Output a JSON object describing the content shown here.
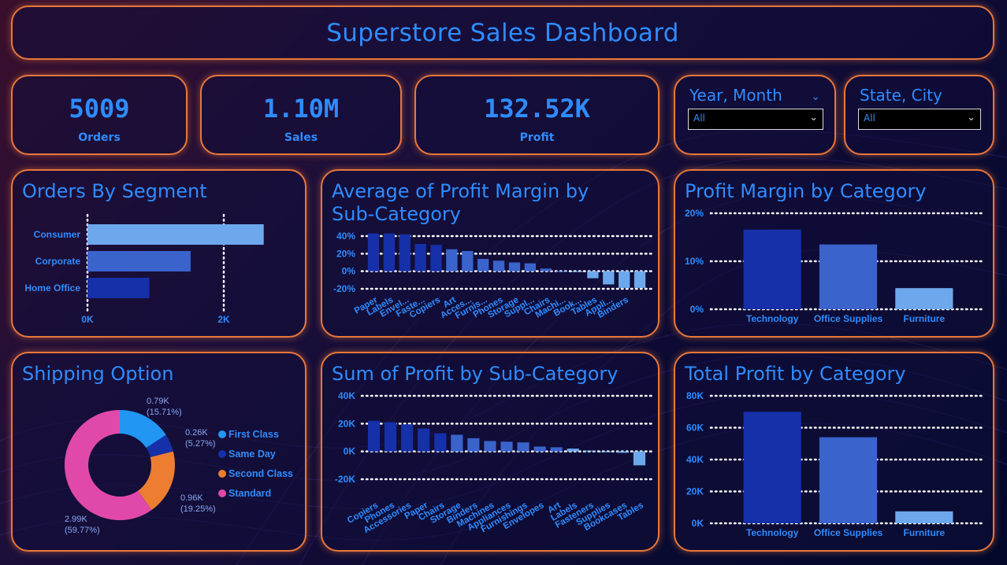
{
  "header": {
    "title": "Superstore Sales Dashboard"
  },
  "kpis": {
    "orders": {
      "value": "5009",
      "label": "Orders"
    },
    "sales": {
      "value": "1.10M",
      "label": "Sales"
    },
    "profit": {
      "value": "132.52K",
      "label": "Profit"
    }
  },
  "filters": {
    "year_month": {
      "label": "Year, Month",
      "value": "All"
    },
    "state_city": {
      "label": "State, City",
      "value": "All"
    }
  },
  "panels": {
    "orders_by_segment": "Orders By Segment",
    "avg_profit_margin_subcat": "Average of Profit Margin by Sub-Category",
    "profit_margin_category": "Profit Margin by Category",
    "shipping_option": "Shipping Option",
    "sum_profit_subcat": "Sum of Profit by Sub-Category",
    "total_profit_category": "Total Profit by Category"
  },
  "colors": {
    "accent": "#2f8cff",
    "border": "#e8773a",
    "bar_dark": "#1530a8",
    "bar_mid": "#3a63cc",
    "bar_light": "#6ea8ec",
    "first_class": "#2196f3",
    "same_day": "#1530a8",
    "second_class": "#ed7d31",
    "standard": "#e049aa"
  },
  "chart_data": [
    {
      "id": "segment",
      "type": "bar",
      "orientation": "horizontal",
      "categories": [
        "Consumer",
        "Corporate",
        "Home Office"
      ],
      "values": [
        2586,
        1514,
        909
      ],
      "xlim": [
        0,
        2000
      ],
      "xticks": [
        "0K",
        "2K"
      ],
      "grid": true
    },
    {
      "id": "avg_margin",
      "type": "bar",
      "categories": [
        "Paper",
        "Labels",
        "Envel...",
        "Faste...",
        "Copiers",
        "Art",
        "Acces...",
        "Furnis...",
        "Phones",
        "Storage",
        "Suppl...",
        "Chairs",
        "Machi...",
        "Book...",
        "Tables",
        "Appli...",
        "Binders"
      ],
      "values": [
        0.43,
        0.43,
        0.42,
        0.31,
        0.3,
        0.25,
        0.23,
        0.14,
        0.12,
        0.1,
        0.09,
        0.03,
        -0.01,
        0.0,
        -0.08,
        -0.15,
        -0.19,
        -0.19
      ],
      "ylim": [
        -0.2,
        0.4
      ],
      "yticks": [
        "-20%",
        "0%",
        "20%",
        "40%"
      ],
      "grid": true
    },
    {
      "id": "margin_category",
      "type": "bar",
      "categories": [
        "Technology",
        "Office Supplies",
        "Furniture"
      ],
      "values": [
        0.166,
        0.135,
        0.044
      ],
      "ylim": [
        0,
        0.2
      ],
      "yticks": [
        "0%",
        "10%",
        "20%"
      ],
      "grid": true
    },
    {
      "id": "shipping",
      "type": "pie",
      "donut": true,
      "legend": "right",
      "series": [
        {
          "name": "First Class",
          "value": 0.79,
          "label": "0.79K",
          "pct": "(15.71%)"
        },
        {
          "name": "Same Day",
          "value": 0.26,
          "label": "0.26K",
          "pct": "(5.27%)"
        },
        {
          "name": "Second Class",
          "value": 0.96,
          "label": "0.96K",
          "pct": "(19.25%)"
        },
        {
          "name": "Standard",
          "value": 2.99,
          "label": "2.99K",
          "pct": "(59.77%)"
        }
      ]
    },
    {
      "id": "sum_profit",
      "type": "bar",
      "categories": [
        "Copiers",
        "Phones",
        "Accessories",
        "Paper",
        "Chairs",
        "Storage",
        "Binders",
        "Machines",
        "Appliances",
        "Furnishings",
        "Envelopes",
        "Art",
        "Labels",
        "Fasteners",
        "Supplies",
        "Bookcases",
        "Tables"
      ],
      "values": [
        22000,
        21000,
        19500,
        16500,
        13000,
        12000,
        9500,
        7500,
        7000,
        6500,
        3500,
        3000,
        2000,
        600,
        -500,
        -1000,
        -10000
      ],
      "ylim": [
        -20000,
        40000
      ],
      "yticks": [
        "-20K",
        "0K",
        "20K",
        "40K"
      ],
      "grid": true
    },
    {
      "id": "total_profit_category",
      "type": "bar",
      "categories": [
        "Technology",
        "Office Supplies",
        "Furniture"
      ],
      "values": [
        70000,
        54000,
        7500
      ],
      "ylim": [
        0,
        80000
      ],
      "yticks": [
        "0K",
        "20K",
        "40K",
        "60K",
        "80K"
      ],
      "grid": true
    }
  ]
}
